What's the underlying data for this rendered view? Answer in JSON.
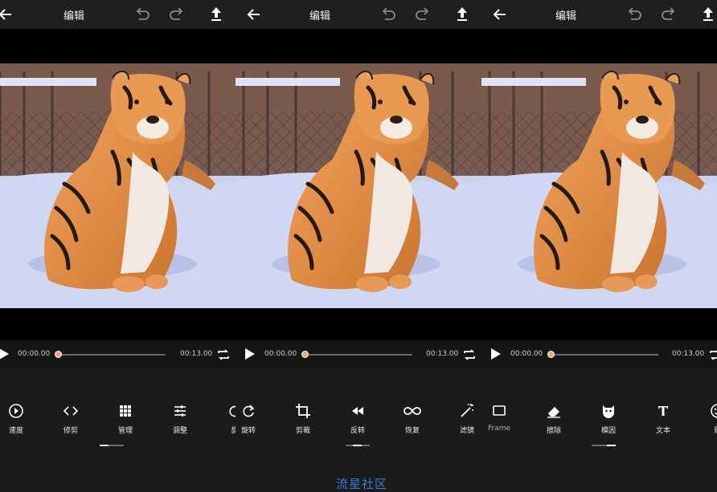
{
  "header": {
    "title": "编辑",
    "back_icon": "back-arrow-icon",
    "undo_icon": "undo-icon",
    "redo_icon": "redo-icon",
    "export_icon": "export-upload-icon"
  },
  "player": {
    "time_current": "00:00.00",
    "time_total": "00:13.00",
    "progress_fraction": 0,
    "accent_color": "#f1a57c"
  },
  "panels": [
    {
      "tools": [
        {
          "icon": "speed-icon",
          "label": "速度"
        },
        {
          "icon": "trim-icon",
          "label": "修剪"
        },
        {
          "icon": "grid-manage-icon",
          "label": "管理"
        },
        {
          "icon": "adjust-sliders-icon",
          "label": "调整"
        },
        {
          "icon": "rotate-icon",
          "label": "旋"
        }
      ],
      "page_indicator_active": 0
    },
    {
      "tools": [
        {
          "icon": "rotate-icon",
          "label": "旋转"
        },
        {
          "icon": "crop-icon",
          "label": "剪裁"
        },
        {
          "icon": "rewind-icon",
          "label": "反转"
        },
        {
          "icon": "infinity-icon",
          "label": "恢复"
        },
        {
          "icon": "magic-wand-icon",
          "label": "滤镜"
        }
      ],
      "page_indicator_active": 1
    },
    {
      "tools": [
        {
          "icon": "frame-icon",
          "label": "Frame"
        },
        {
          "icon": "eraser-icon",
          "label": "擦除"
        },
        {
          "icon": "mask-icon",
          "label": "模因"
        },
        {
          "icon": "text-icon",
          "label": "文本"
        },
        {
          "icon": "sticker-icon",
          "label": "贴"
        }
      ],
      "page_indicator_active": 2
    }
  ],
  "watermark": "流星社区"
}
